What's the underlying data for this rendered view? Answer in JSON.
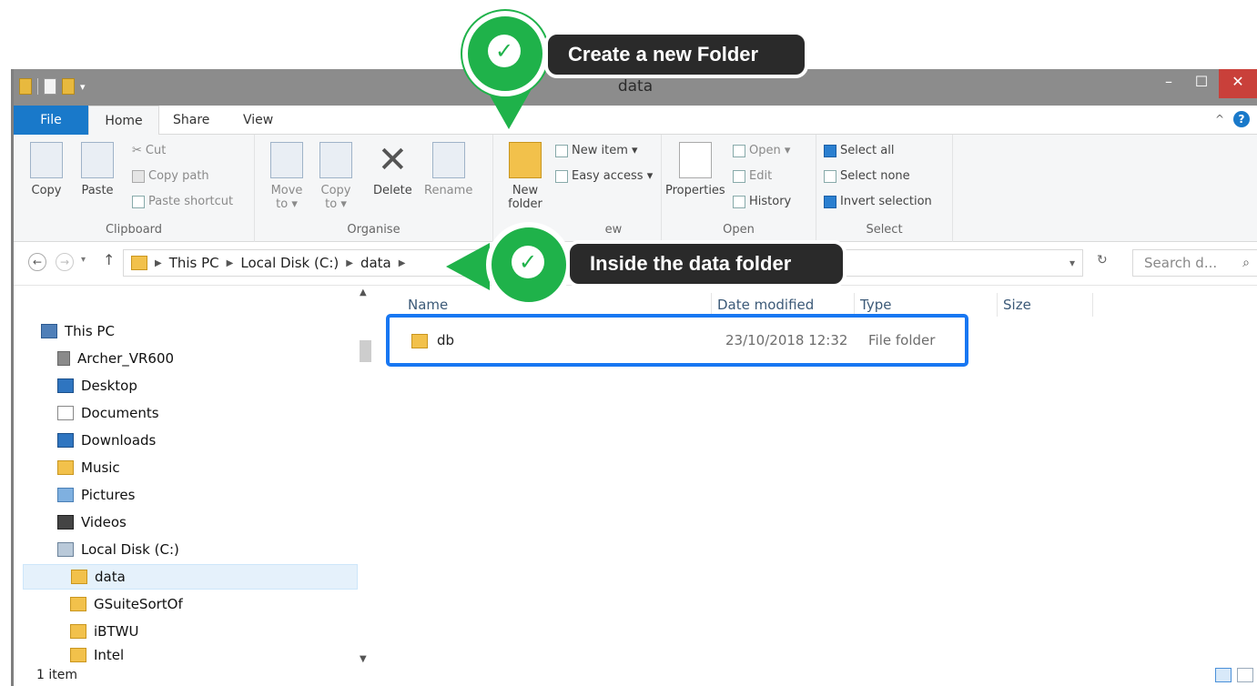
{
  "window": {
    "title": "data",
    "minimize": "–",
    "maximize": "☐",
    "close": "✕"
  },
  "ribbon": {
    "tabs": [
      "File",
      "Home",
      "Share",
      "View"
    ],
    "help": "?",
    "collapse": "^",
    "clipboard": {
      "label": "Clipboard",
      "copy": "Copy",
      "paste": "Paste",
      "cut": "Cut",
      "copy_path": "Copy path",
      "paste_shortcut": "Paste shortcut"
    },
    "organise": {
      "label": "Organise",
      "move_to": "Move to ▾",
      "copy_to": "Copy to ▾",
      "delete": "Delete",
      "rename": "Rename"
    },
    "new": {
      "new_folder": "New folder",
      "new_item": "New item ▾",
      "easy_access": "Easy access ▾",
      "label_partial": "ew"
    },
    "open": {
      "label": "Open",
      "properties": "Properties",
      "open": "Open ▾",
      "edit": "Edit",
      "history": "History"
    },
    "select": {
      "label": "Select",
      "select_all": "Select all",
      "select_none": "Select none",
      "invert_selection": "Invert selection"
    }
  },
  "address": {
    "crumbs": [
      "This PC",
      "Local Disk (C:)",
      "data"
    ],
    "search_placeholder": "Search d..."
  },
  "navpane": {
    "items": [
      {
        "label": "This PC",
        "icon": "computer-icon"
      },
      {
        "label": "Archer_VR600",
        "icon": "network-drive-icon"
      },
      {
        "label": "Desktop",
        "icon": "desktop-icon"
      },
      {
        "label": "Documents",
        "icon": "documents-icon"
      },
      {
        "label": "Downloads",
        "icon": "downloads-icon"
      },
      {
        "label": "Music",
        "icon": "music-icon"
      },
      {
        "label": "Pictures",
        "icon": "pictures-icon"
      },
      {
        "label": "Videos",
        "icon": "videos-icon"
      },
      {
        "label": "Local Disk (C:)",
        "icon": "disk-icon"
      },
      {
        "label": "data",
        "icon": "folder-icon",
        "selected": true
      },
      {
        "label": "GSuiteSortOf",
        "icon": "folder-icon"
      },
      {
        "label": "iBTWU",
        "icon": "folder-icon"
      },
      {
        "label": "Intel",
        "icon": "folder-icon"
      }
    ]
  },
  "content": {
    "columns": [
      "Name",
      "Date modified",
      "Type",
      "Size"
    ],
    "rows": [
      {
        "name": "db",
        "date": "23/10/2018 12:32",
        "type": "File folder",
        "size": ""
      }
    ]
  },
  "status": {
    "count": "1 item"
  },
  "annotations": {
    "top": "Create a new Folder",
    "middle": "Inside the data folder",
    "check": "✓"
  },
  "colors": {
    "accent": "#1979ca",
    "annotation_green": "#1fb24a",
    "highlight_blue": "#1877f2",
    "folder_yellow": "#f2c14b"
  }
}
